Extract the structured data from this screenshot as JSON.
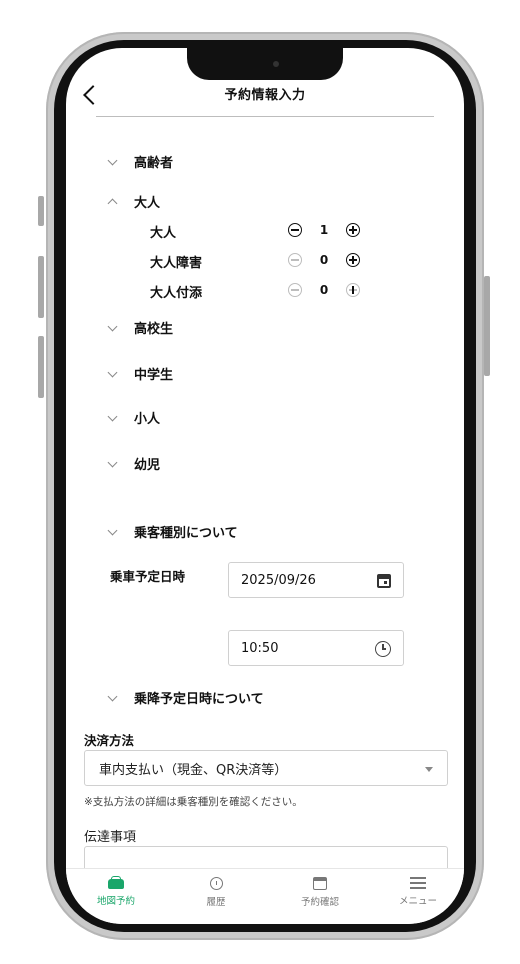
{
  "header": {
    "title": "予約情報入力"
  },
  "categories": {
    "elderly": "高齢者",
    "adult": "大人",
    "high_school": "高校生",
    "middle_school": "中学生",
    "child": "小人",
    "infant": "幼児"
  },
  "adult_sub": [
    {
      "label": "大人",
      "count": "1"
    },
    {
      "label": "大人障害",
      "count": "0"
    },
    {
      "label": "大人付添",
      "count": "0"
    }
  ],
  "passenger_info_toggle": "乗客種別について",
  "boarding": {
    "label": "乗車予定日時",
    "date": "2025/09/26",
    "time": "10:50"
  },
  "boarding_info_toggle": "乗降予定日時について",
  "payment": {
    "label": "決済方法",
    "selected": "車内支払い（現金、QR決済等）",
    "note": "※支払方法の詳細は乗客種別を確認ください。"
  },
  "memo": {
    "label": "伝達事項"
  },
  "nav": {
    "map_reserve": "地図予約",
    "history": "履歴",
    "reservation_check": "予約確認",
    "menu": "メニュー"
  },
  "colors": {
    "accent": "#1aa66a"
  }
}
